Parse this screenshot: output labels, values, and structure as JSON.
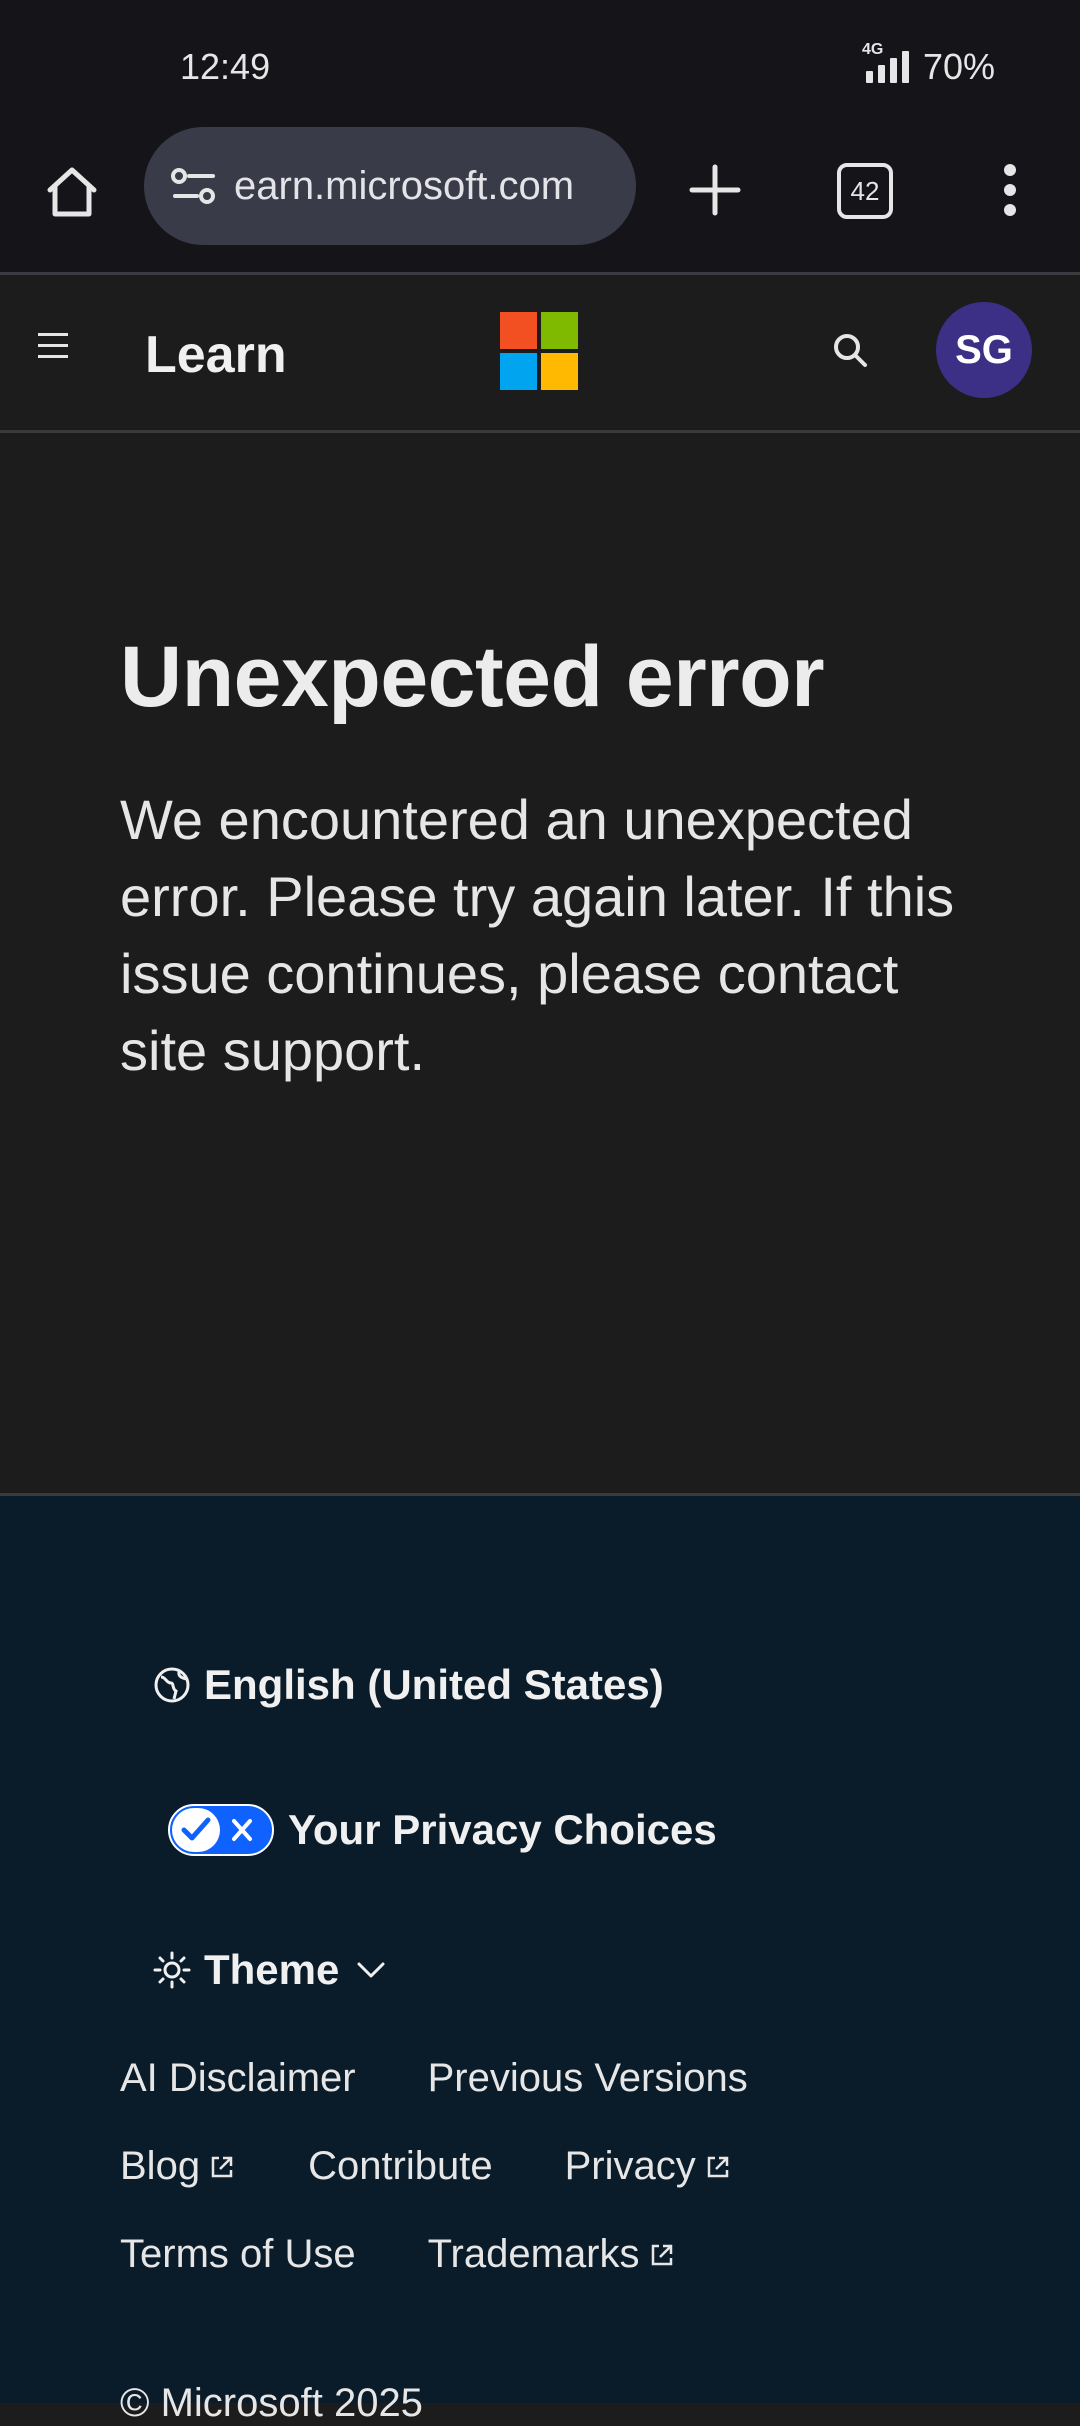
{
  "status_bar": {
    "time": "12:49",
    "network": "4G",
    "battery": "70%"
  },
  "browser": {
    "url": "earn.microsoft.com",
    "tab_count": "42"
  },
  "site_header": {
    "brand_label": "Learn",
    "avatar_initials": "SG",
    "logo_colors": [
      "#f25022",
      "#7fba00",
      "#00a4ef",
      "#ffb900"
    ]
  },
  "main": {
    "title": "Unexpected error",
    "message": "We encountered an unexpected error. Please try again later. If this issue continues, please contact site support."
  },
  "footer": {
    "language": "English (United States)",
    "privacy_choices": "Your Privacy Choices",
    "theme": "Theme",
    "links": {
      "ai_disclaimer": "AI Disclaimer",
      "previous_versions": "Previous Versions",
      "blog": "Blog",
      "contribute": "Contribute",
      "privacy": "Privacy",
      "terms": "Terms of Use",
      "trademarks": "Trademarks"
    },
    "copyright": "© Microsoft 2025"
  },
  "colors": {
    "accent_toggle": "#0f62fe",
    "avatar_bg": "#3b2f86",
    "footer_bg": "#0a1b29"
  }
}
